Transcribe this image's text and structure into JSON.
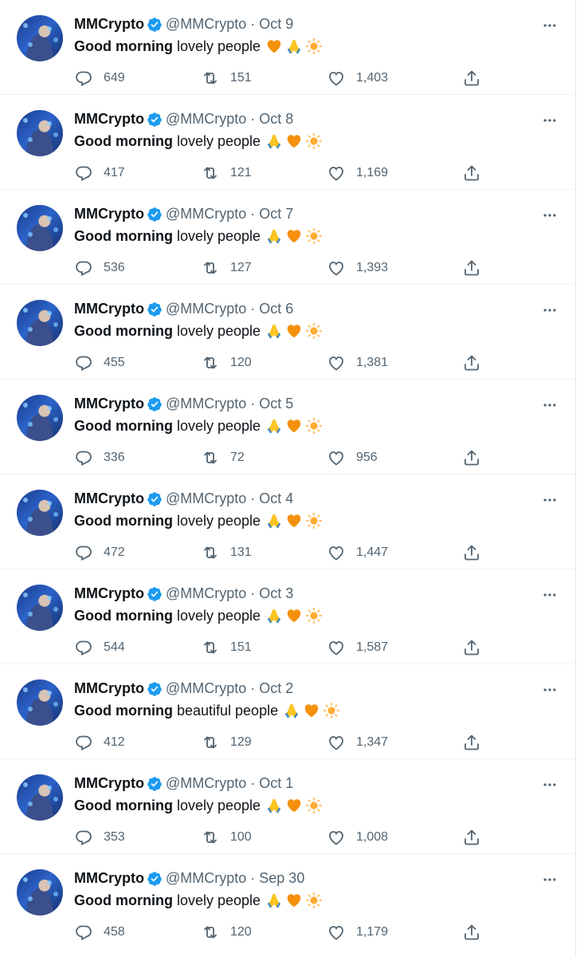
{
  "colors": {
    "verified": "#1d9bf0",
    "secondary_text": "#536471",
    "heart_emoji": "#f4900c",
    "pray_emoji": "#fcc21b",
    "sun_emoji": "#ffac33"
  },
  "icons": {
    "verified": "verified-badge-icon",
    "more": "more-options-icon",
    "reply": "reply-icon",
    "retweet": "retweet-icon",
    "like": "like-icon",
    "share": "share-icon"
  },
  "tweets": [
    {
      "name": "MMCrypto",
      "handle": "@MMCrypto",
      "date": "Oct 9",
      "greeting": "Good morning",
      "rest": "lovely people",
      "emojis": [
        "orange-heart",
        "folded-hands",
        "sun"
      ],
      "replies": "649",
      "retweets": "151",
      "likes": "1,403"
    },
    {
      "name": "MMCrypto",
      "handle": "@MMCrypto",
      "date": "Oct 8",
      "greeting": "Good morning",
      "rest": "lovely people",
      "emojis": [
        "folded-hands",
        "orange-heart",
        "sun"
      ],
      "replies": "417",
      "retweets": "121",
      "likes": "1,169"
    },
    {
      "name": "MMCrypto",
      "handle": "@MMCrypto",
      "date": "Oct 7",
      "greeting": "Good morning",
      "rest": "lovely people",
      "emojis": [
        "folded-hands",
        "orange-heart",
        "sun"
      ],
      "replies": "536",
      "retweets": "127",
      "likes": "1,393"
    },
    {
      "name": "MMCrypto",
      "handle": "@MMCrypto",
      "date": "Oct 6",
      "greeting": "Good morning",
      "rest": "lovely people",
      "emojis": [
        "folded-hands",
        "orange-heart",
        "sun"
      ],
      "replies": "455",
      "retweets": "120",
      "likes": "1,381"
    },
    {
      "name": "MMCrypto",
      "handle": "@MMCrypto",
      "date": "Oct 5",
      "greeting": "Good morning",
      "rest": "lovely people",
      "emojis": [
        "folded-hands",
        "orange-heart",
        "sun"
      ],
      "replies": "336",
      "retweets": "72",
      "likes": "956"
    },
    {
      "name": "MMCrypto",
      "handle": "@MMCrypto",
      "date": "Oct 4",
      "greeting": "Good morning",
      "rest": "lovely people",
      "emojis": [
        "folded-hands",
        "orange-heart",
        "sun"
      ],
      "replies": "472",
      "retweets": "131",
      "likes": "1,447"
    },
    {
      "name": "MMCrypto",
      "handle": "@MMCrypto",
      "date": "Oct 3",
      "greeting": "Good morning",
      "rest": "lovely people",
      "emojis": [
        "folded-hands",
        "orange-heart",
        "sun"
      ],
      "replies": "544",
      "retweets": "151",
      "likes": "1,587"
    },
    {
      "name": "MMCrypto",
      "handle": "@MMCrypto",
      "date": "Oct 2",
      "greeting": "Good morning",
      "rest": "beautiful people",
      "emojis": [
        "folded-hands",
        "orange-heart",
        "sun"
      ],
      "replies": "412",
      "retweets": "129",
      "likes": "1,347"
    },
    {
      "name": "MMCrypto",
      "handle": "@MMCrypto",
      "date": "Oct 1",
      "greeting": "Good morning",
      "rest": "lovely people",
      "emojis": [
        "folded-hands",
        "orange-heart",
        "sun"
      ],
      "replies": "353",
      "retweets": "100",
      "likes": "1,008"
    },
    {
      "name": "MMCrypto",
      "handle": "@MMCrypto",
      "date": "Sep 30",
      "greeting": "Good morning",
      "rest": "lovely people",
      "emojis": [
        "folded-hands",
        "orange-heart",
        "sun"
      ],
      "replies": "458",
      "retweets": "120",
      "likes": "1,179"
    }
  ]
}
